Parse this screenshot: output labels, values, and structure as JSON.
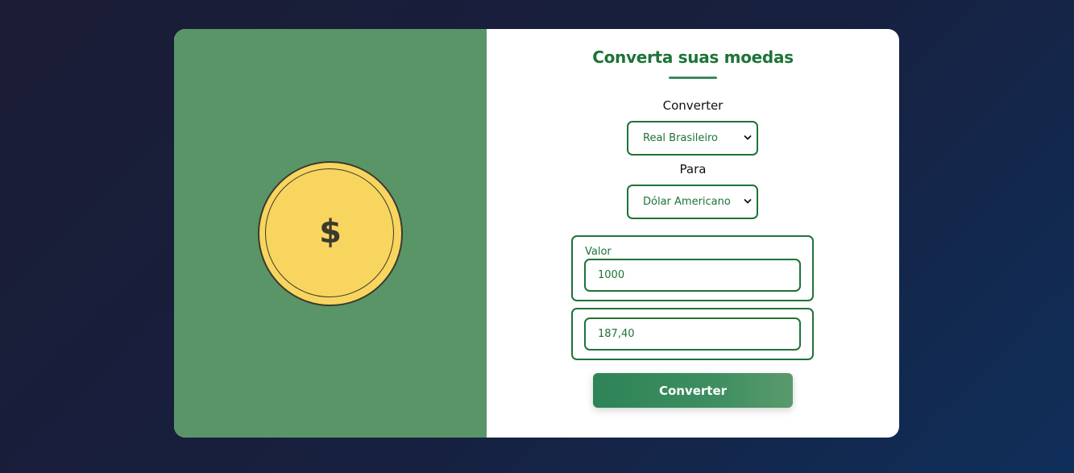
{
  "title": "Converta suas moedas",
  "coin": {
    "symbol": "$"
  },
  "form": {
    "from_label": "Converter",
    "from_selected": "Real Brasileiro",
    "to_label": "Para",
    "to_selected": "Dólar Americano",
    "amount_label": "Valor",
    "amount_value": "1000",
    "result_value": "187,40",
    "submit_label": "Converter"
  },
  "colors": {
    "accent": "#1e7338",
    "left_panel": "#5a9567",
    "coin": "#f8d55f"
  }
}
